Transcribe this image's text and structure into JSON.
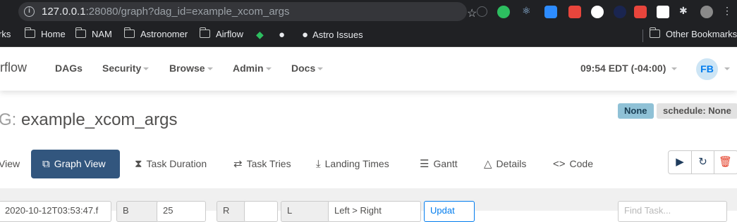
{
  "browser": {
    "url_host": "127.0.0.1",
    "url_rest": ":28080/graph?dag_id=example_xcom_args",
    "bookmarks_prefix": "rks",
    "bookmarks": [
      "Home",
      "NAM",
      "Astronomer",
      "Airflow",
      "Astro Issues"
    ],
    "other_bookmarks": "Other Bookmarks"
  },
  "navbar": {
    "brand": "rflow",
    "items": [
      "DAGs",
      "Security",
      "Browse",
      "Admin",
      "Docs"
    ],
    "time": "09:54 EDT (-04:00)",
    "avatar": "FB"
  },
  "dag": {
    "title_prefix": "G:",
    "title": "example_xcom_args",
    "owner_label": "None",
    "schedule_label": "schedule: None"
  },
  "tabs": [
    "View",
    "Graph View",
    "Task Duration",
    "Task Tries",
    "Landing Times",
    "Gantt",
    "Details",
    "Code"
  ],
  "form": {
    "date_value": "2020-10-12T03:53:47.f",
    "base_label": "B",
    "base_value": "25",
    "runs_label": "R",
    "layout_label": "L",
    "layout_value": "Left > Right",
    "update": "Updat",
    "find_placeholder": "Find Task..."
  }
}
